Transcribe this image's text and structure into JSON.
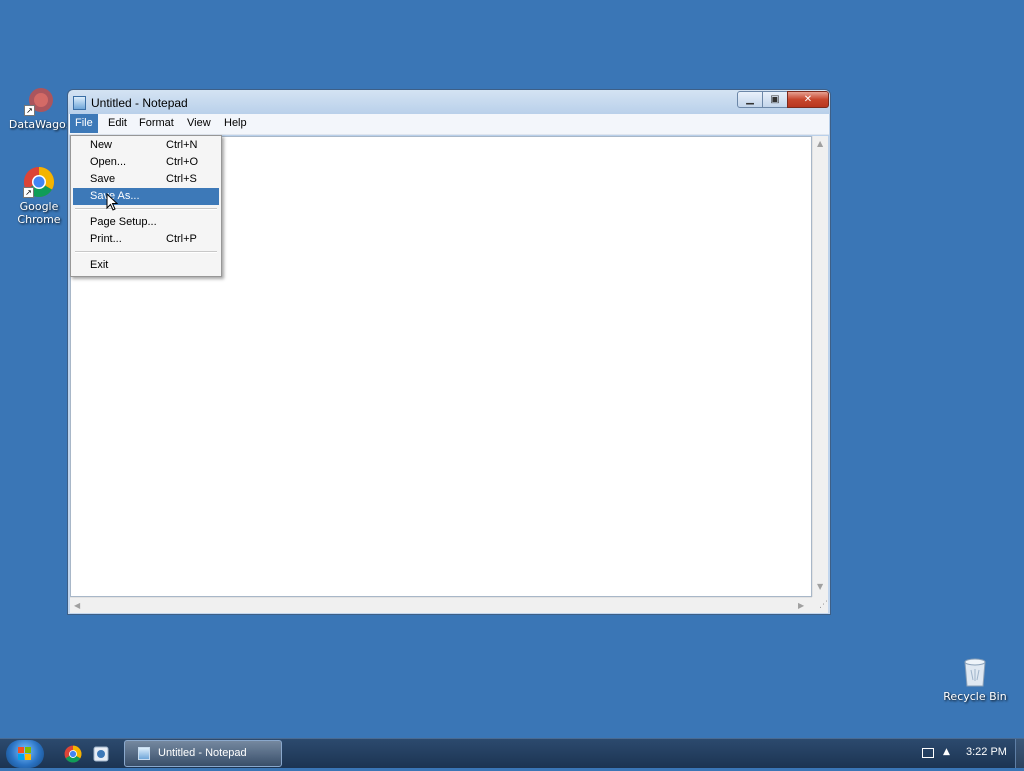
{
  "desktop": {
    "icons": [
      {
        "label": "DataWago.",
        "icon": "datawago-icon"
      },
      {
        "label": "Google\nChrome",
        "icon": "chrome-icon"
      },
      {
        "label": "Recycle Bin",
        "icon": "recycle-bin-icon"
      }
    ],
    "background": "#3a76b6"
  },
  "window": {
    "title": "Untitled - Notepad",
    "controls": {
      "minimize": "minimize-icon",
      "maximize": "maximize-icon",
      "close": "close-icon"
    },
    "menu": [
      "File",
      "Edit",
      "Format",
      "View",
      "Help"
    ],
    "active_menu": "File"
  },
  "file_menu": {
    "items": [
      {
        "label": "New",
        "shortcut": "Ctrl+N"
      },
      {
        "label": "Open...",
        "shortcut": "Ctrl+O"
      },
      {
        "label": "Save",
        "shortcut": "Ctrl+S"
      },
      {
        "label": "Save As...",
        "shortcut": ""
      },
      {
        "label": "Page Setup...",
        "shortcut": ""
      },
      {
        "label": "Print...",
        "shortcut": "Ctrl+P"
      },
      {
        "label": "Exit",
        "shortcut": ""
      }
    ],
    "highlighted": "Save As..."
  },
  "taskbar": {
    "task_label": "Untitled - Notepad",
    "clock": "3:22 PM",
    "pinned": [
      "chrome-icon",
      "datawago-icon"
    ]
  },
  "colors": {
    "highlight": "#3d79b8",
    "close_button": "#c7462d",
    "taskbar": "#1c3452"
  }
}
